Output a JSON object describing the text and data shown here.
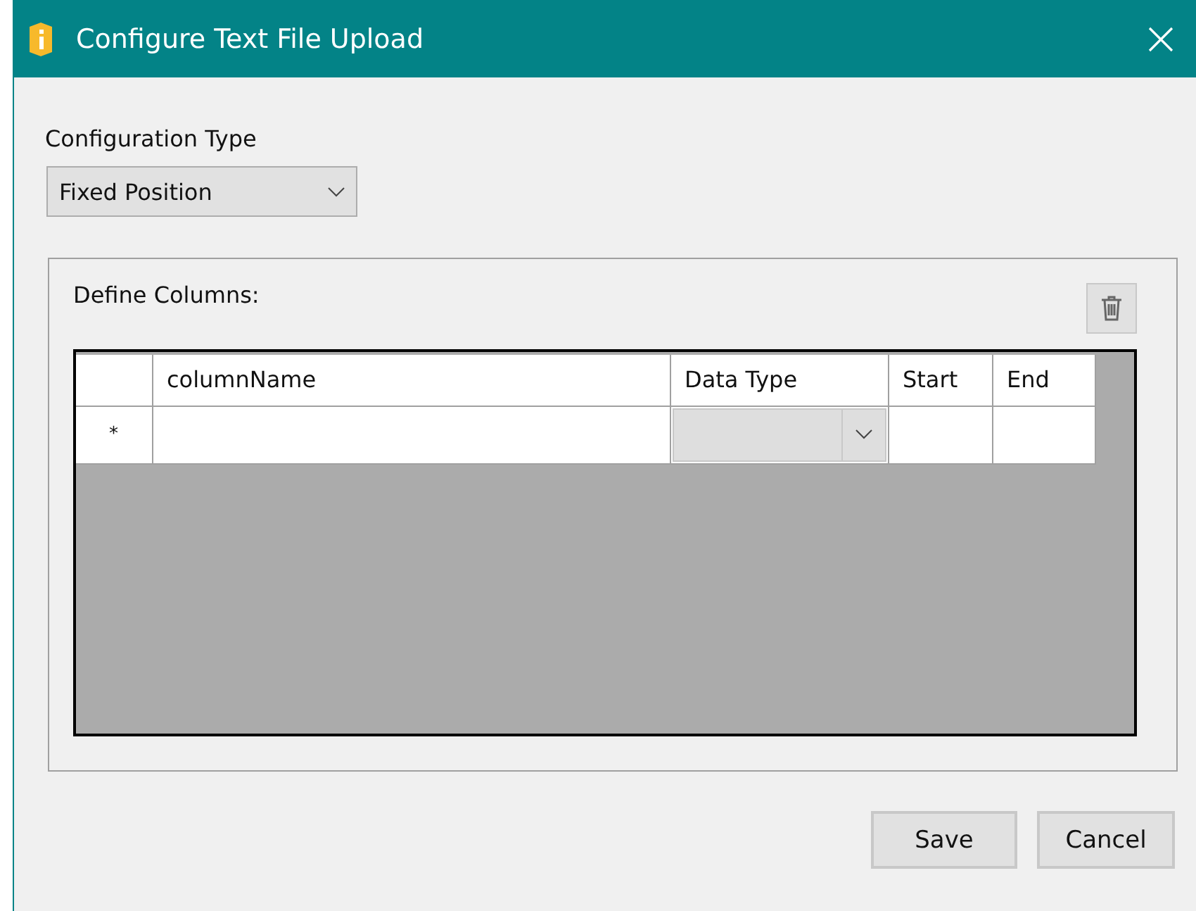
{
  "window": {
    "title": "Configure Text File Upload"
  },
  "configuration_type": {
    "label": "Configuration Type",
    "value": "Fixed Position"
  },
  "define_columns": {
    "label": "Define Columns:",
    "table": {
      "columns": [
        "columnName",
        "Data Type",
        "Start",
        "End"
      ],
      "rows": [
        {
          "marker": "*",
          "columnName": "",
          "data_type": "",
          "start": "",
          "end": ""
        }
      ]
    }
  },
  "buttons": [
    "Save",
    "Cancel"
  ]
}
